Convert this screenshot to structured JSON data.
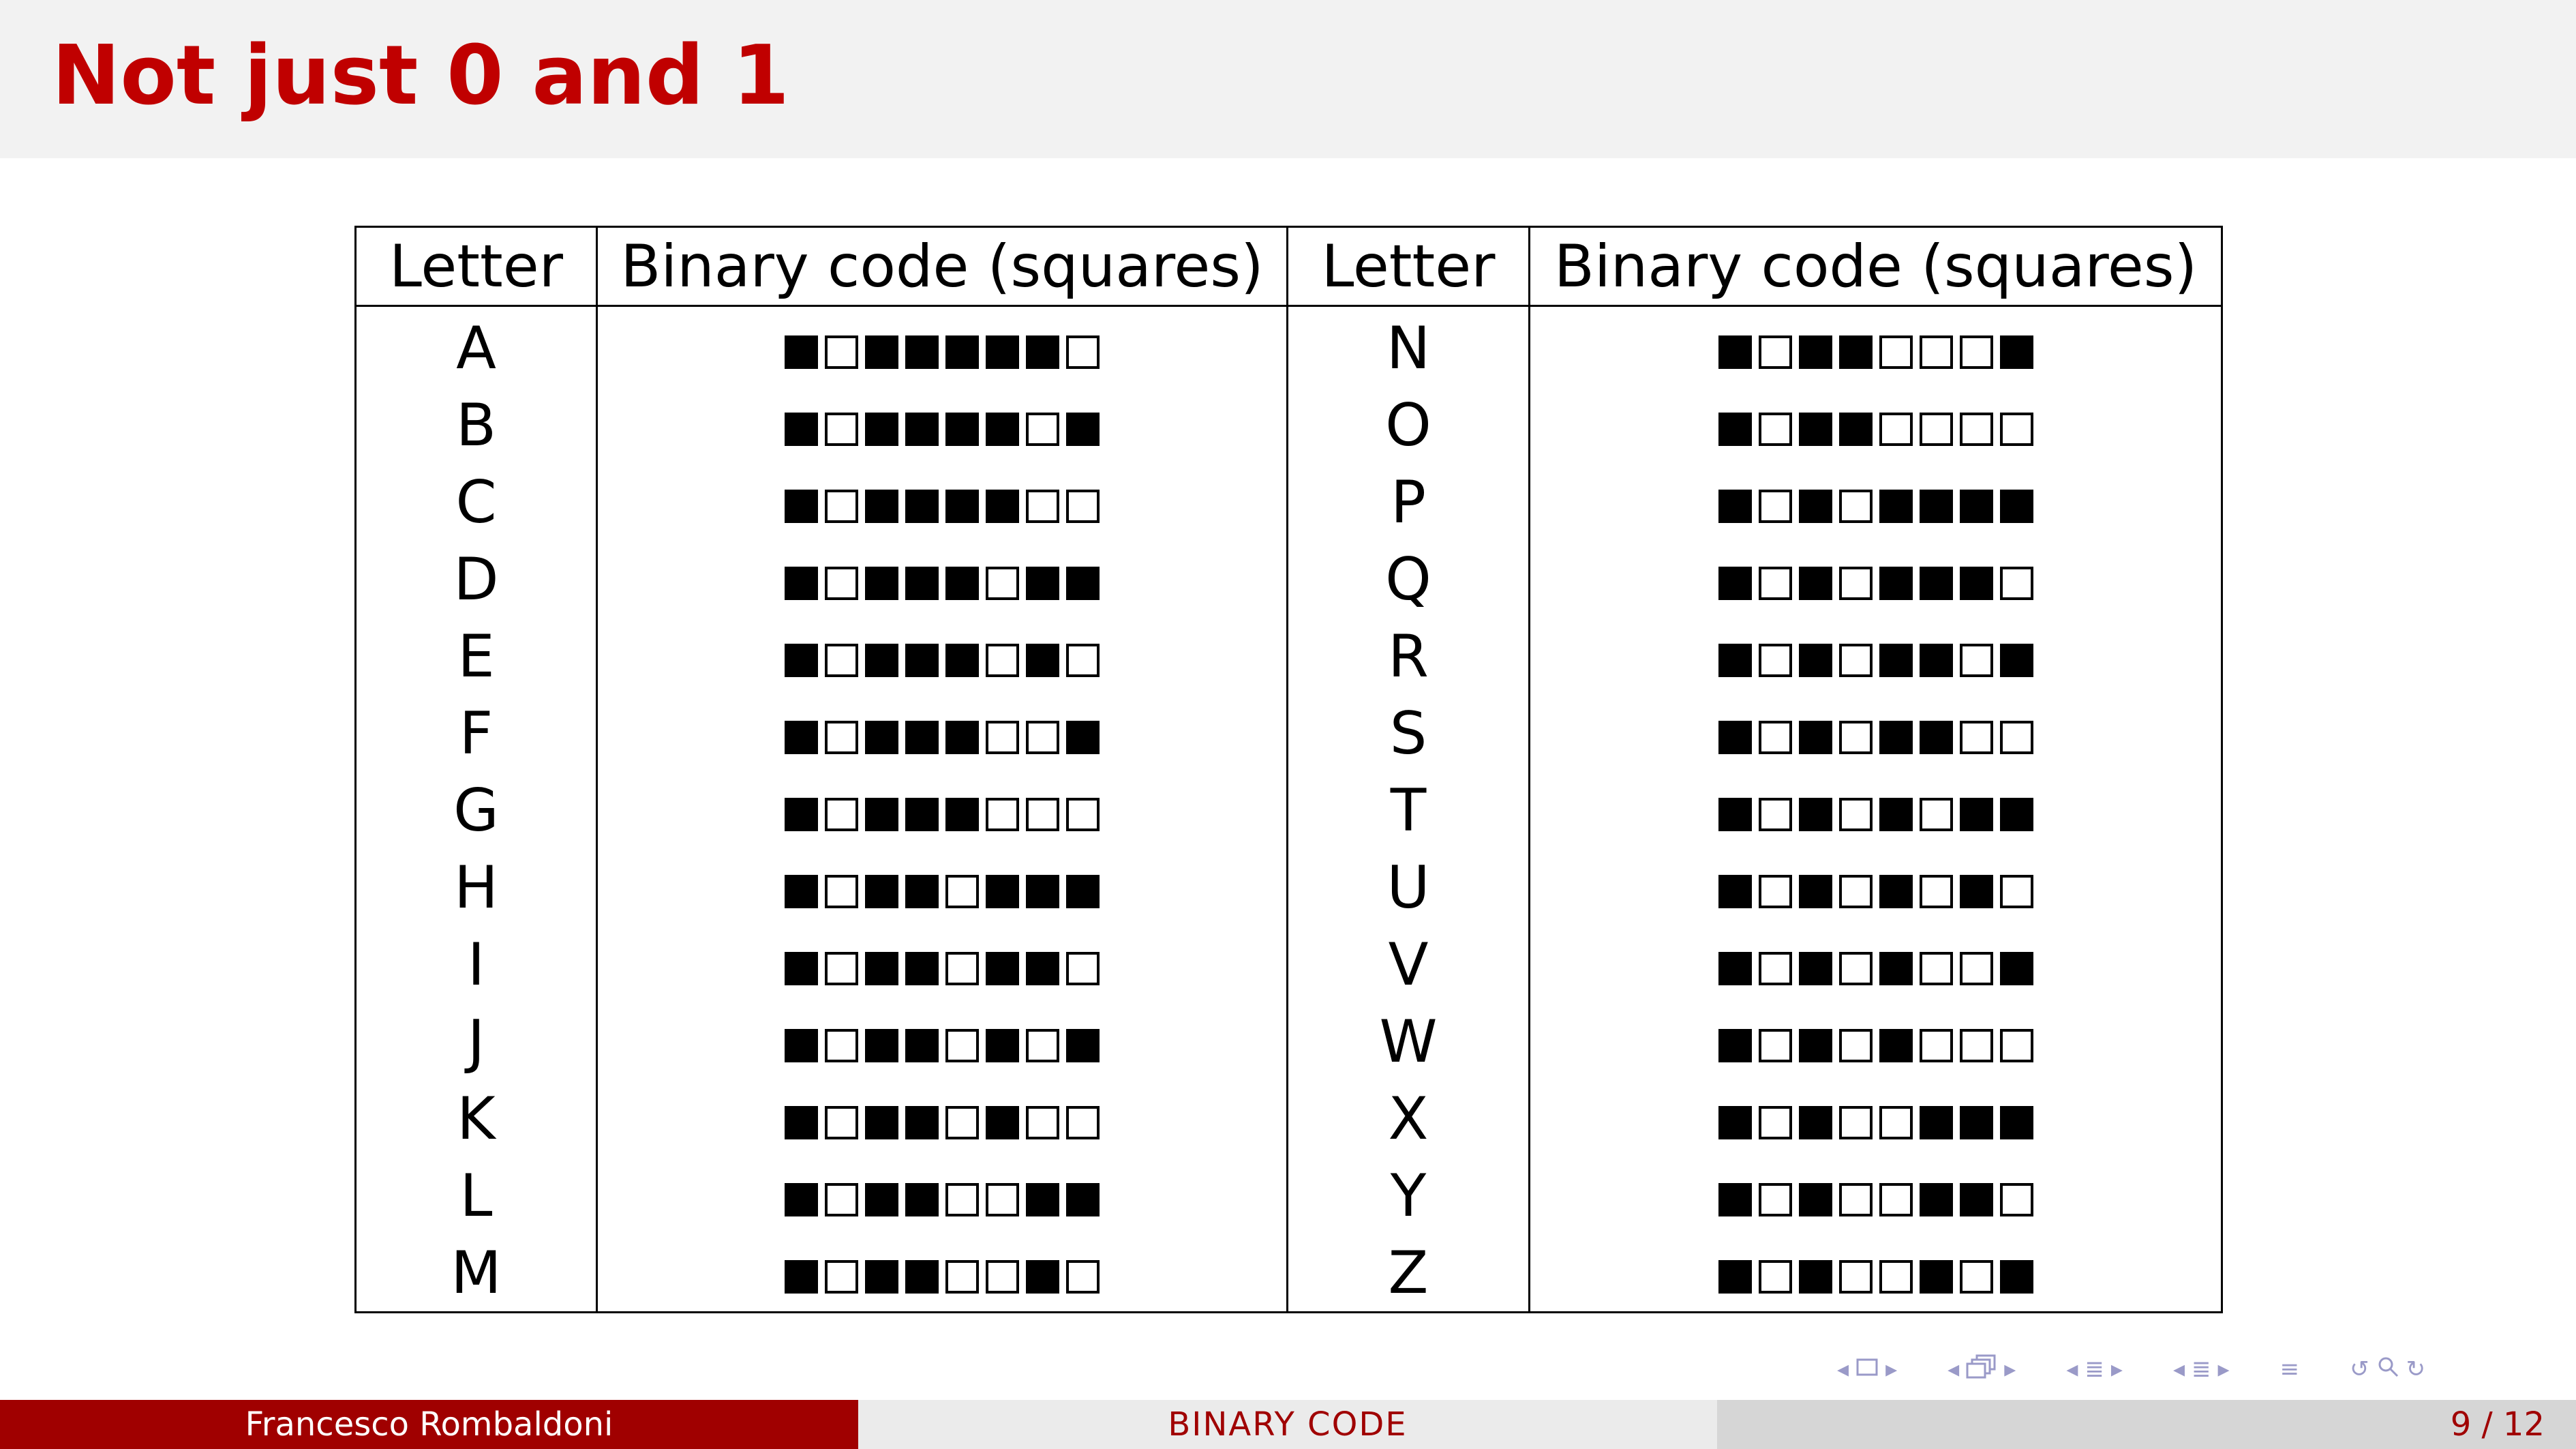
{
  "slide": {
    "title": "Not just 0 and 1"
  },
  "table": {
    "headers": [
      "Letter",
      "Binary code (squares)",
      "Letter",
      "Binary code (squares)"
    ],
    "rows": [
      {
        "left_letter": "A",
        "left_code": "01000001",
        "right_letter": "N",
        "right_code": "01001110"
      },
      {
        "left_letter": "B",
        "left_code": "01000010",
        "right_letter": "O",
        "right_code": "01001111"
      },
      {
        "left_letter": "C",
        "left_code": "01000011",
        "right_letter": "P",
        "right_code": "01010000"
      },
      {
        "left_letter": "D",
        "left_code": "01000100",
        "right_letter": "Q",
        "right_code": "01010001"
      },
      {
        "left_letter": "E",
        "left_code": "01000101",
        "right_letter": "R",
        "right_code": "01010010"
      },
      {
        "left_letter": "F",
        "left_code": "01000110",
        "right_letter": "S",
        "right_code": "01010011"
      },
      {
        "left_letter": "G",
        "left_code": "01000111",
        "right_letter": "T",
        "right_code": "01010100"
      },
      {
        "left_letter": "H",
        "left_code": "01001000",
        "right_letter": "U",
        "right_code": "01010101"
      },
      {
        "left_letter": "I",
        "left_code": "01001001",
        "right_letter": "V",
        "right_code": "01010110"
      },
      {
        "left_letter": "J",
        "left_code": "01001010",
        "right_letter": "W",
        "right_code": "01010111"
      },
      {
        "left_letter": "K",
        "left_code": "01001011",
        "right_letter": "X",
        "right_code": "01011000"
      },
      {
        "left_letter": "L",
        "left_code": "01001100",
        "right_letter": "Y",
        "right_code": "01011001"
      },
      {
        "left_letter": "M",
        "left_code": "01001101",
        "right_letter": "Z",
        "right_code": "01011010"
      }
    ]
  },
  "square_encoding": {
    "filled_square": "0",
    "empty_square": "1"
  },
  "nav_controls": {
    "icons": [
      "frame-prev-icon",
      "frame-icon",
      "frame-next-icon",
      "subsection-prev-icon",
      "subsection-icon",
      "subsection-next-icon",
      "section-prev-icon",
      "section-icon",
      "section-next-icon",
      "section2-prev-icon",
      "section2-icon",
      "section2-next-icon",
      "align-icon",
      "back-icon",
      "search-icon",
      "forward-icon"
    ]
  },
  "footer": {
    "author": "Francesco Rombaldoni",
    "title": "BINARY CODE",
    "page": "9 / 12"
  },
  "colors": {
    "accent_red": "#c00000",
    "footer_red": "#a00000",
    "header_band": "#f2f2f2",
    "nav_icons": "#9a9ac8"
  }
}
